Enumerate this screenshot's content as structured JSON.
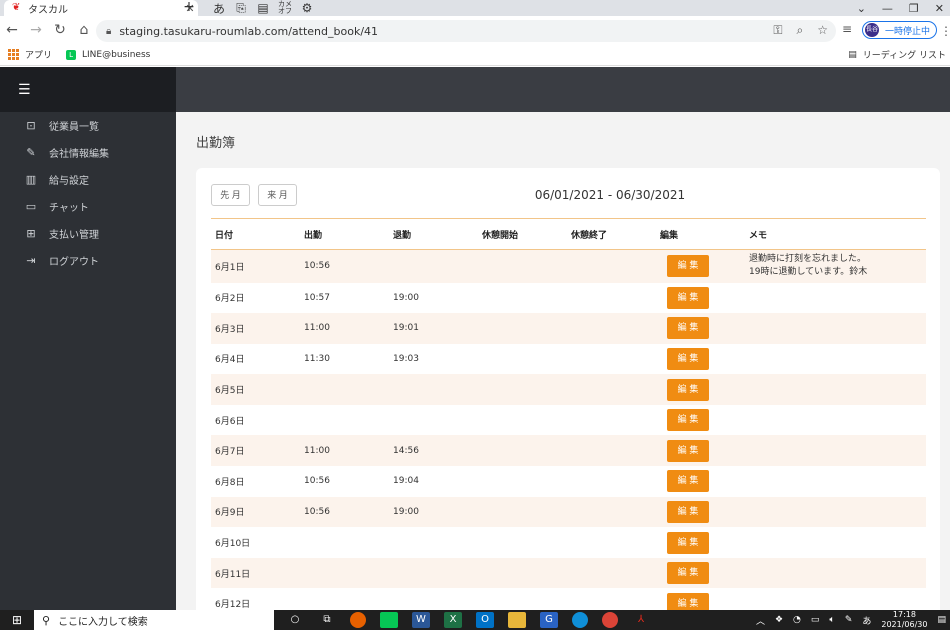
{
  "browser": {
    "tab_title": "タスカル",
    "tab_close": "✕",
    "new_tab": "+",
    "ext_icons": [
      "あ",
      "⎘",
      "▤",
      "カメ\nオフ",
      "⚙"
    ],
    "window_controls": [
      "⌄",
      "—",
      "❐",
      "✕"
    ],
    "url": "staging.tasukaru-roumlab.com/attend_book/41",
    "pause_label": "一時停止中",
    "avatar_text": "長谷",
    "bookmarks": [
      "アプリ",
      "LINE@business"
    ],
    "reading_list": "リーディング リスト"
  },
  "sidebar": {
    "menu_icon": "☰",
    "items": [
      {
        "icon": "person-icon",
        "glyph": "⊡",
        "label": "従業員一覧"
      },
      {
        "icon": "edit-icon",
        "glyph": "✎",
        "label": "会社情報編集"
      },
      {
        "icon": "chart-icon",
        "glyph": "▥",
        "label": "給与設定"
      },
      {
        "icon": "chat-icon",
        "glyph": "▭",
        "label": "チャット"
      },
      {
        "icon": "payment-icon",
        "glyph": "⊞",
        "label": "支払い管理"
      },
      {
        "icon": "logout-icon",
        "glyph": "⇥",
        "label": "ログアウト"
      }
    ]
  },
  "main": {
    "page_title": "出勤簿",
    "prev_month": "先 月",
    "next_month": "来 月",
    "date_range": "06/01/2021 - 06/30/2021",
    "columns": [
      "日付",
      "出勤",
      "退勤",
      "休憩開始",
      "休憩終了",
      "編集",
      "メモ"
    ],
    "edit_label": "編 集",
    "rows": [
      {
        "date": "6月1日",
        "in": "10:56",
        "out": "",
        "break_start": "",
        "break_end": "",
        "memo_line1": "退勤時に打刻を忘れました。",
        "memo_line2": "19時に退勤しています。鈴木"
      },
      {
        "date": "6月2日",
        "in": "10:57",
        "out": "19:00",
        "break_start": "",
        "break_end": "",
        "memo_line1": "",
        "memo_line2": ""
      },
      {
        "date": "6月3日",
        "in": "11:00",
        "out": "19:01",
        "break_start": "",
        "break_end": "",
        "memo_line1": "",
        "memo_line2": ""
      },
      {
        "date": "6月4日",
        "in": "11:30",
        "out": "19:03",
        "break_start": "",
        "break_end": "",
        "memo_line1": "",
        "memo_line2": ""
      },
      {
        "date": "6月5日",
        "in": "",
        "out": "",
        "break_start": "",
        "break_end": "",
        "memo_line1": "",
        "memo_line2": ""
      },
      {
        "date": "6月6日",
        "in": "",
        "out": "",
        "break_start": "",
        "break_end": "",
        "memo_line1": "",
        "memo_line2": ""
      },
      {
        "date": "6月7日",
        "in": "11:00",
        "out": "14:56",
        "break_start": "",
        "break_end": "",
        "memo_line1": "",
        "memo_line2": ""
      },
      {
        "date": "6月8日",
        "in": "10:56",
        "out": "19:04",
        "break_start": "",
        "break_end": "",
        "memo_line1": "",
        "memo_line2": ""
      },
      {
        "date": "6月9日",
        "in": "10:56",
        "out": "19:00",
        "break_start": "",
        "break_end": "",
        "memo_line1": "",
        "memo_line2": ""
      },
      {
        "date": "6月10日",
        "in": "",
        "out": "",
        "break_start": "",
        "break_end": "",
        "memo_line1": "",
        "memo_line2": ""
      },
      {
        "date": "6月11日",
        "in": "",
        "out": "",
        "break_start": "",
        "break_end": "",
        "memo_line1": "",
        "memo_line2": ""
      },
      {
        "date": "6月12日",
        "in": "",
        "out": "",
        "break_start": "",
        "break_end": "",
        "memo_line1": "",
        "memo_line2": ""
      }
    ]
  },
  "taskbar": {
    "search_placeholder": "ここに入力して検索",
    "ime": "あ",
    "time": "17:18",
    "date": "2021/06/30"
  }
}
